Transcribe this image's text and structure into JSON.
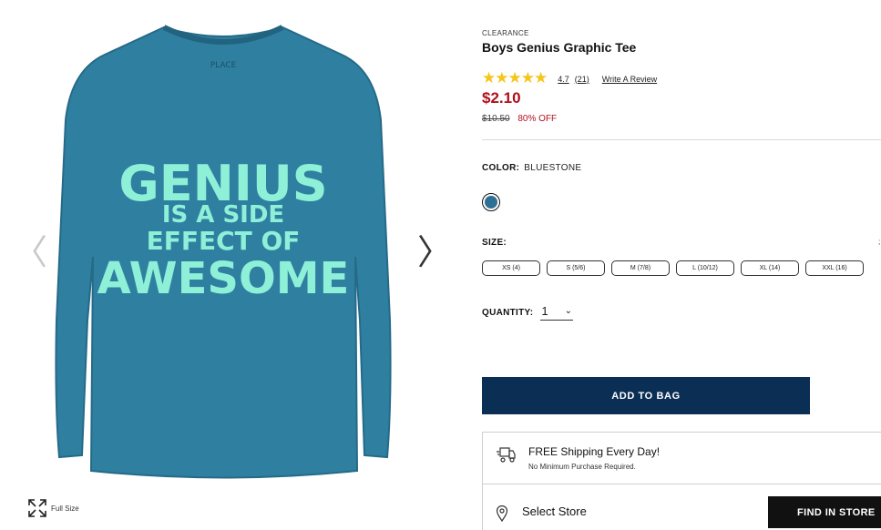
{
  "gallery": {
    "prev_icon": "chevron-left-icon",
    "next_icon": "chevron-right-icon",
    "prev_glyph": "〈",
    "next_glyph": "〉",
    "neck_label_top": "PLACE",
    "print_lines": [
      "GENIUS",
      "IS A SIDE",
      "EFFECT OF",
      "AWESOME"
    ],
    "full_size_label": "Full Size",
    "shirt_color": "#2f7fa1",
    "print_color": "#8ff0d8"
  },
  "product": {
    "eyebrow": "CLEARANCE",
    "title": "Boys Genius Graphic Tee",
    "rating_value": 4.7,
    "rating_text": "4.7",
    "review_count": "(21)",
    "write_review": "Write A Review",
    "price": "$2.10",
    "was_price": "$10.50",
    "discount": "80% OFF"
  },
  "color": {
    "label": "COLOR:",
    "value": "BLUESTONE",
    "swatch_hex": "#2f6f93"
  },
  "size": {
    "label": "SIZE:",
    "more": ";",
    "options": [
      "XS (4)",
      "S (5/6)",
      "M (7/8)",
      "L (10/12)",
      "XL (14)",
      "XXL (16)"
    ]
  },
  "quantity": {
    "label": "QUANTITY:",
    "value": "1"
  },
  "actions": {
    "add_to_bag": "ADD TO BAG",
    "find_in_store": "FIND IN STORE"
  },
  "shipping": {
    "title": "FREE Shipping Every Day!",
    "subtitle": "No Minimum Purchase Required."
  },
  "store": {
    "label": "Select Store"
  },
  "colors": {
    "brand_navy": "#0b2e55",
    "sale_red": "#b0101e",
    "star_gold": "#f5c518"
  }
}
